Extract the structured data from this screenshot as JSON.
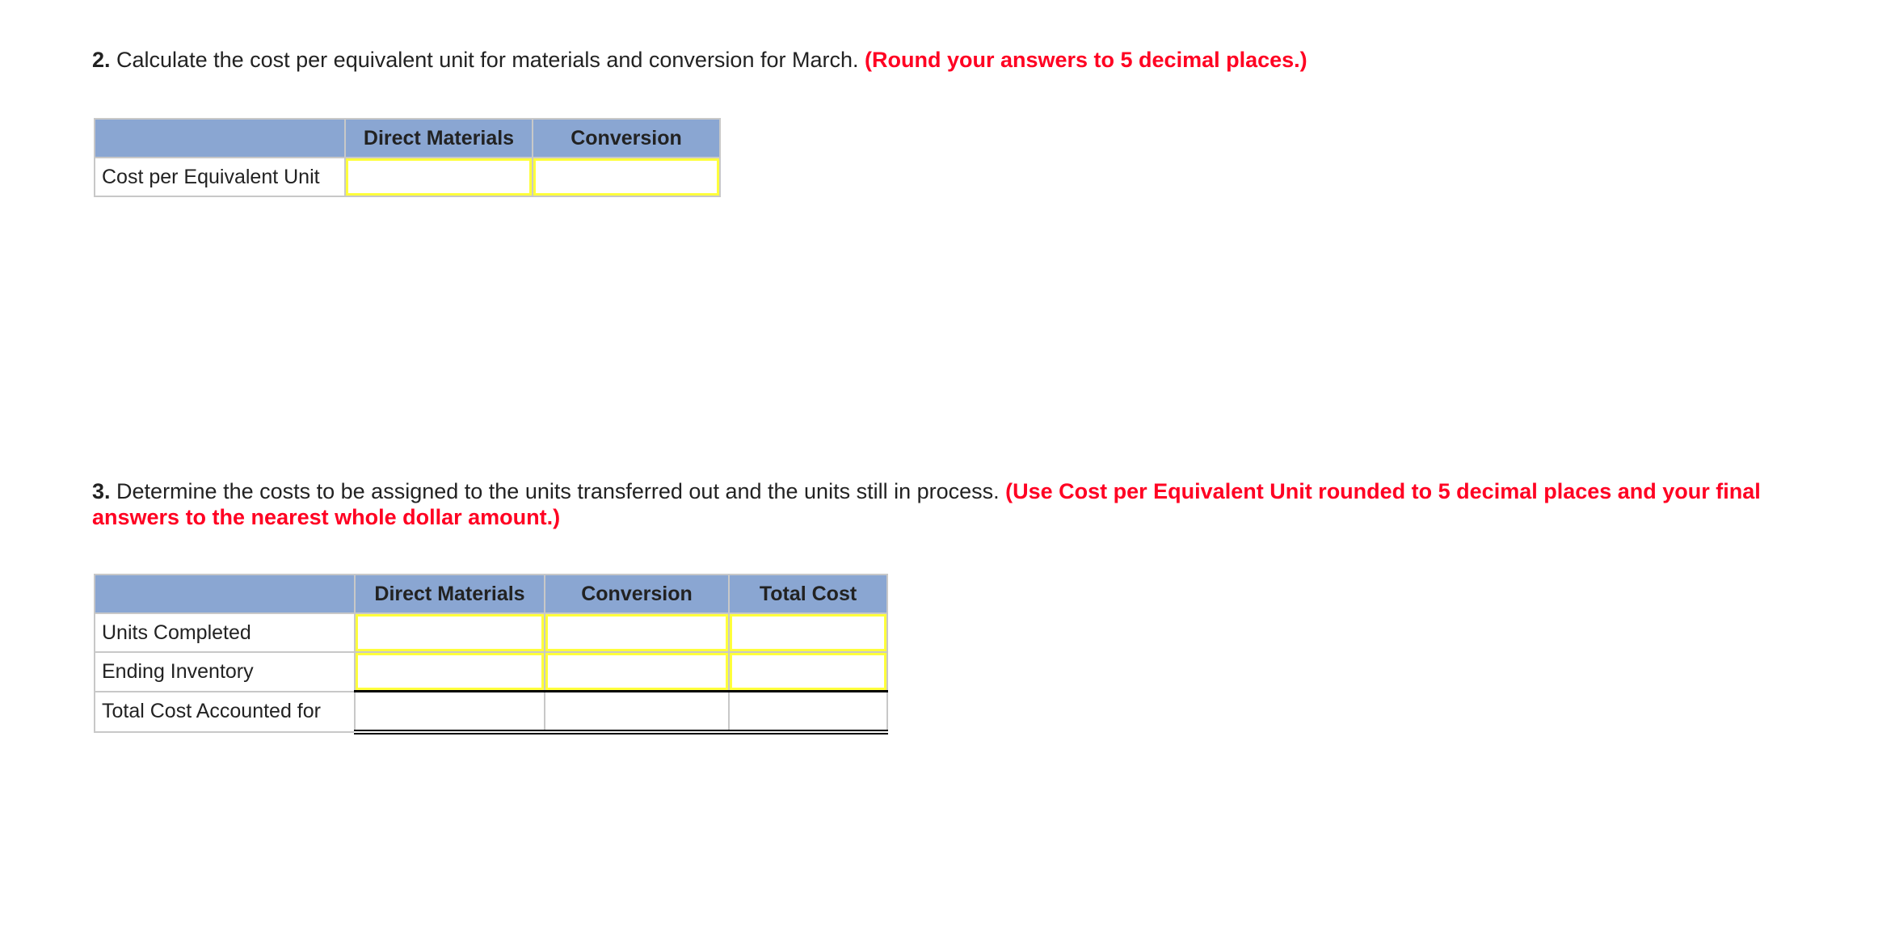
{
  "colors": {
    "header_bg": "#8aa6d2",
    "input_border": "#ffff3c",
    "instruction_red": "#ff0022",
    "grid_border": "#c8c8c8",
    "text": "#222222"
  },
  "question2": {
    "number": "2.",
    "text": " Calculate the cost per equivalent unit for materials and conversion for March. ",
    "instruction": "(Round your answers to 5 decimal places.)",
    "table": {
      "headers": [
        "",
        "Direct Materials",
        "Conversion"
      ],
      "rows": [
        {
          "label": "Cost per Equivalent Unit",
          "direct_materials": "",
          "conversion": ""
        }
      ]
    }
  },
  "question3": {
    "number": "3.",
    "text": " Determine the costs to be assigned to the units transferred out and the units still in process. ",
    "instruction": "(Use Cost per Equivalent Unit rounded to 5 decimal places and your final answers to the nearest whole dollar amount.)",
    "table": {
      "headers": [
        "",
        "Direct Materials",
        "Conversion",
        "Total Cost"
      ],
      "rows": [
        {
          "label": "Units Completed",
          "direct_materials": "",
          "conversion": "",
          "total_cost": ""
        },
        {
          "label": "Ending Inventory",
          "direct_materials": "",
          "conversion": "",
          "total_cost": ""
        },
        {
          "label": "Total Cost Accounted for",
          "direct_materials": "",
          "conversion": "",
          "total_cost": ""
        }
      ]
    }
  }
}
